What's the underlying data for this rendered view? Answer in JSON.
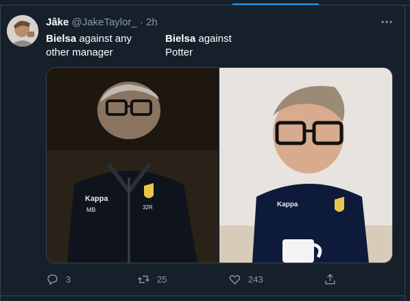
{
  "tweet": {
    "display_name": "Jâke",
    "handle": "@JakeTaylor_",
    "separator": "·",
    "time": "2h",
    "text_left": {
      "bold": "Bielsa",
      "rest": " against any",
      "line2": "other manager"
    },
    "text_right": {
      "bold": "Bielsa",
      "rest": " against",
      "line2": "Potter"
    }
  },
  "actions": {
    "reply_count": "3",
    "retweet_count": "25",
    "like_count": "243"
  },
  "icons": [
    "more-icon",
    "reply-icon",
    "retweet-icon",
    "like-icon",
    "share-icon"
  ],
  "colors": {
    "background": "#15202b",
    "accent": "#1d9bf0",
    "muted": "#8b98a5",
    "border": "#38444d"
  }
}
